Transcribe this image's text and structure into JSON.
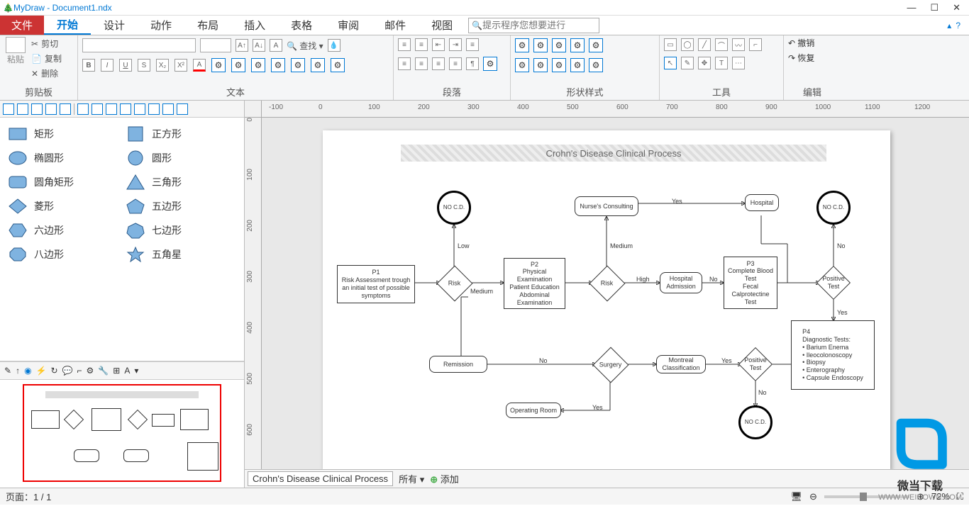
{
  "window": {
    "title": "MyDraw - Document1.ndx"
  },
  "menu": {
    "file": "文件",
    "tabs": [
      "开始",
      "设计",
      "动作",
      "布局",
      "插入",
      "表格",
      "审阅",
      "邮件",
      "视图"
    ],
    "search_placeholder": "提示程序您想要进行"
  },
  "ribbon": {
    "clipboard": {
      "paste": "粘贴",
      "cut": "剪切",
      "copy": "复制",
      "delete": "删除",
      "label": "剪贴板"
    },
    "text": {
      "find": "查找",
      "label": "文本"
    },
    "paragraph": {
      "label": "段落"
    },
    "shapestyle": {
      "label": "形状样式"
    },
    "tools": {
      "label": "工具"
    },
    "edit": {
      "undo": "撤销",
      "redo": "恢复",
      "label": "编辑"
    }
  },
  "shapes": [
    {
      "name": "矩形"
    },
    {
      "name": "正方形"
    },
    {
      "name": "椭圆形"
    },
    {
      "name": "圆形"
    },
    {
      "name": "圆角矩形"
    },
    {
      "name": "三角形"
    },
    {
      "name": "菱形"
    },
    {
      "name": "五边形"
    },
    {
      "name": "六边形"
    },
    {
      "name": "七边形"
    },
    {
      "name": "八边形"
    },
    {
      "name": "五角星"
    }
  ],
  "diagram": {
    "title": "Crohn's Disease Clinical Process",
    "p1": "P1\nRisk Assessment trough an initial test of possible symptoms",
    "p2": "P2\nPhysical Examination\nPatient Education\nAbdominal Examination",
    "p3": "P3\nComplete Blood Test\nFecal Calprotectine Test",
    "p4": "P4\nDiagnostic Tests:\n• Barium Enema\n• Ileocolonoscopy\n• Biopsy\n• Enterography\n• Capsule Endoscopy",
    "risk": "Risk",
    "nocd": "NO C.D.",
    "nurse": "Nurse's Consulting",
    "hospital": "Hospital",
    "hospadm": "Hospital Admission",
    "postest": "Positive Test",
    "remission": "Remission",
    "surgery": "Surgery",
    "montreal": "Montreal Classification",
    "oproom": "Operating Room",
    "low": "Low",
    "medium": "Medium",
    "high": "High",
    "yes": "Yes",
    "no": "No"
  },
  "ruler_h": [
    -100,
    0,
    100,
    200,
    300,
    400,
    500,
    600,
    700,
    800,
    900,
    1000,
    1100,
    1200
  ],
  "ruler_v": [
    0,
    100,
    200,
    300,
    400,
    500,
    600
  ],
  "pagetab": {
    "name": "Crohn's Disease Clinical Process",
    "all": "所有",
    "add": "添加"
  },
  "status": {
    "page": "页面：1 / 1",
    "zoom": "72%"
  },
  "watermark": {
    "text": "微当下载",
    "url": "WWW.WEIDOWN.COM"
  }
}
